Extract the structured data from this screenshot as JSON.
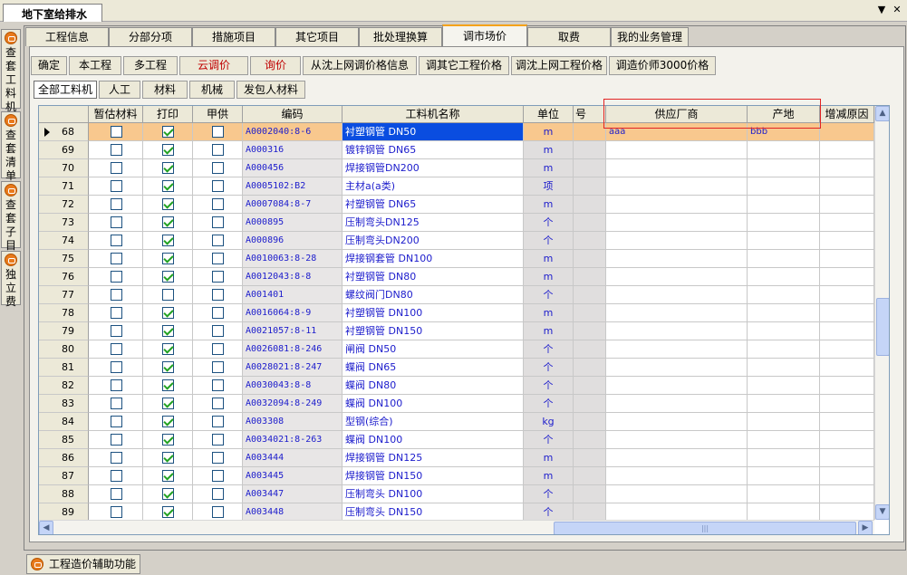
{
  "window": {
    "doc_tab": "地下室给排水",
    "dropdown_glyph": "▼",
    "close_glyph": "✕"
  },
  "side_tabs": [
    {
      "label": "查套工料机"
    },
    {
      "label": "查套清单"
    },
    {
      "label": "查套子目"
    },
    {
      "label": "独立费"
    }
  ],
  "top_tabs": [
    {
      "label": "工程信息"
    },
    {
      "label": "分部分项"
    },
    {
      "label": "措施项目"
    },
    {
      "label": "其它项目"
    },
    {
      "label": "批处理换算"
    },
    {
      "label": "调市场价"
    },
    {
      "label": "取费"
    },
    {
      "label": "我的业务管理"
    }
  ],
  "active_tab": "调市场价",
  "toolbar": [
    {
      "label": "确定"
    },
    {
      "label": "本工程"
    },
    {
      "label": "多工程"
    },
    {
      "label": "云调价",
      "color": "#c00000"
    },
    {
      "label": "询价",
      "color": "#c00000"
    },
    {
      "label": "从沈上网调价格信息"
    },
    {
      "label": "调其它工程价格"
    },
    {
      "label": "调沈上网工程价格"
    },
    {
      "label": "调造价师3000价格"
    }
  ],
  "subtabs": [
    {
      "label": "全部工料机"
    },
    {
      "label": "人工"
    },
    {
      "label": "材料"
    },
    {
      "label": "机械"
    },
    {
      "label": "发包人材料"
    }
  ],
  "columns": {
    "est": "暂估材料",
    "print": "打印",
    "jia": "甲供",
    "code": "编码",
    "name": "工料机名称",
    "unit": "单位",
    "hao": "号",
    "supplier": "供应厂商",
    "origin": "产地",
    "reason": "增减原因"
  },
  "rows": [
    {
      "num": "68",
      "est": false,
      "print": true,
      "jia": false,
      "code": "A0002040:8-6",
      "name": "衬塑钢管 DN50",
      "unit": "m",
      "supplier": "aaa",
      "origin": "bbb",
      "selected": true
    },
    {
      "num": "69",
      "est": false,
      "print": true,
      "jia": false,
      "code": "A000316",
      "name": "镀锌钢管 DN65",
      "unit": "m"
    },
    {
      "num": "70",
      "est": false,
      "print": true,
      "jia": false,
      "code": "A000456",
      "name": "焊接钢管DN200",
      "unit": "m"
    },
    {
      "num": "71",
      "est": false,
      "print": true,
      "jia": false,
      "code": "A0005102:B2",
      "name": "主材a(a类)",
      "unit": "项"
    },
    {
      "num": "72",
      "est": false,
      "print": true,
      "jia": false,
      "code": "A0007084:8-7",
      "name": "衬塑钢管 DN65",
      "unit": "m"
    },
    {
      "num": "73",
      "est": false,
      "print": true,
      "jia": false,
      "code": "A000895",
      "name": "压制弯头DN125",
      "unit": "个"
    },
    {
      "num": "74",
      "est": false,
      "print": true,
      "jia": false,
      "code": "A000896",
      "name": "压制弯头DN200",
      "unit": "个"
    },
    {
      "num": "75",
      "est": false,
      "print": true,
      "jia": false,
      "code": "A0010063:8-28",
      "name": "焊接钢套管 DN100",
      "unit": "m"
    },
    {
      "num": "76",
      "est": false,
      "print": true,
      "jia": false,
      "code": "A0012043:8-8",
      "name": "衬塑钢管 DN80",
      "unit": "m"
    },
    {
      "num": "77",
      "est": false,
      "print": false,
      "jia": false,
      "code": "A001401",
      "name": "螺纹阀门DN80",
      "unit": "个"
    },
    {
      "num": "78",
      "est": false,
      "print": true,
      "jia": false,
      "code": "A0016064:8-9",
      "name": "衬塑钢管 DN100",
      "unit": "m"
    },
    {
      "num": "79",
      "est": false,
      "print": true,
      "jia": false,
      "code": "A0021057:8-11",
      "name": "衬塑钢管 DN150",
      "unit": "m"
    },
    {
      "num": "80",
      "est": false,
      "print": true,
      "jia": false,
      "code": "A0026081:8-246",
      "name": "闸阀 DN50",
      "unit": "个"
    },
    {
      "num": "81",
      "est": false,
      "print": true,
      "jia": false,
      "code": "A0028021:8-247",
      "name": "蝶阀 DN65",
      "unit": "个"
    },
    {
      "num": "82",
      "est": false,
      "print": true,
      "jia": false,
      "code": "A0030043:8-8",
      "name": "蝶阀 DN80",
      "unit": "个"
    },
    {
      "num": "83",
      "est": false,
      "print": true,
      "jia": false,
      "code": "A0032094:8-249",
      "name": "蝶阀 DN100",
      "unit": "个"
    },
    {
      "num": "84",
      "est": false,
      "print": true,
      "jia": false,
      "code": "A003308",
      "name": "型钢(综合)",
      "unit": "kg"
    },
    {
      "num": "85",
      "est": false,
      "print": true,
      "jia": false,
      "code": "A0034021:8-263",
      "name": "蝶阀 DN100",
      "unit": "个"
    },
    {
      "num": "86",
      "est": false,
      "print": true,
      "jia": false,
      "code": "A003444",
      "name": "焊接钢管 DN125",
      "unit": "m"
    },
    {
      "num": "87",
      "est": false,
      "print": true,
      "jia": false,
      "code": "A003445",
      "name": "焊接钢管 DN150",
      "unit": "m"
    },
    {
      "num": "88",
      "est": false,
      "print": true,
      "jia": false,
      "code": "A003447",
      "name": "压制弯头 DN100",
      "unit": "个"
    },
    {
      "num": "89",
      "est": false,
      "print": true,
      "jia": false,
      "code": "A003448",
      "name": "压制弯头 DN150",
      "unit": "个"
    }
  ],
  "scroll": {
    "up": "▲",
    "down": "▼",
    "left": "◀",
    "right": "▶",
    "grip": "|||"
  },
  "bottom_tab": "工程造价辅助功能"
}
